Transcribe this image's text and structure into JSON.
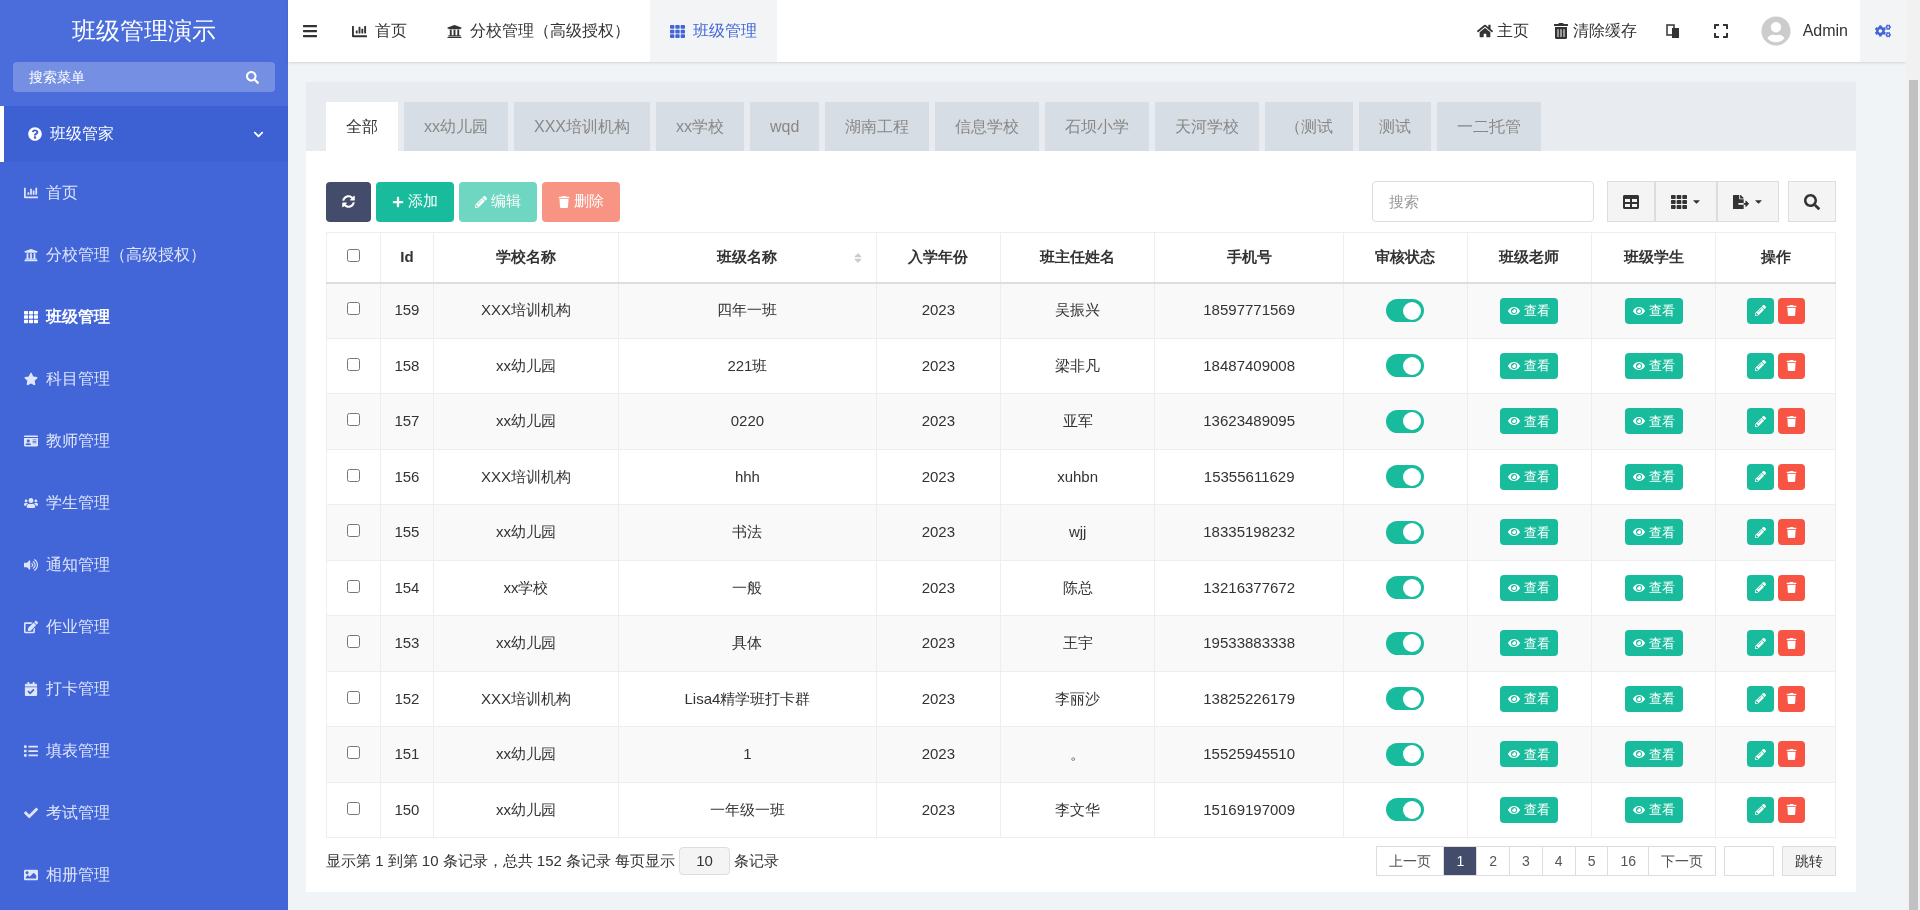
{
  "sidebar": {
    "title": "班级管理演示",
    "search": {
      "placeholder": "搜索菜单"
    },
    "group": {
      "label": "班级管家",
      "expanded": true
    },
    "items": [
      {
        "label": "首页",
        "selected": false
      },
      {
        "label": "分校管理（高级授权）",
        "selected": false
      },
      {
        "label": "班级管理",
        "selected": true
      },
      {
        "label": "科目管理",
        "selected": false
      },
      {
        "label": "教师管理",
        "selected": false
      },
      {
        "label": "学生管理",
        "selected": false
      },
      {
        "label": "通知管理",
        "selected": false
      },
      {
        "label": "作业管理",
        "selected": false
      },
      {
        "label": "打卡管理",
        "selected": false
      },
      {
        "label": "填表管理",
        "selected": false
      },
      {
        "label": "考试管理",
        "selected": false
      },
      {
        "label": "相册管理",
        "selected": false
      }
    ]
  },
  "topbar": {
    "tabs": [
      {
        "label": "首页",
        "selected": false
      },
      {
        "label": "分校管理（高级授权）",
        "selected": false
      },
      {
        "label": "班级管理",
        "selected": true
      }
    ],
    "home": "主页",
    "clear_cache": "清除缓存",
    "user": "Admin"
  },
  "filter_tabs": [
    {
      "label": "全部",
      "selected": true
    },
    {
      "label": "xx幼儿园",
      "selected": false
    },
    {
      "label": "XXX培训机构",
      "selected": false
    },
    {
      "label": "xx学校",
      "selected": false
    },
    {
      "label": "wqd",
      "selected": false
    },
    {
      "label": "湖南工程",
      "selected": false
    },
    {
      "label": "信息学校",
      "selected": false
    },
    {
      "label": "石坝小学",
      "selected": false
    },
    {
      "label": "天河学校",
      "selected": false
    },
    {
      "label": "（测试",
      "selected": false
    },
    {
      "label": "测试",
      "selected": false
    },
    {
      "label": "一二托管",
      "selected": false
    }
  ],
  "toolbar": {
    "add": "添加",
    "edit": "编辑",
    "delete": "删除",
    "search": {
      "placeholder": "搜索"
    }
  },
  "table": {
    "columns": [
      "Id",
      "学校名称",
      "班级名称",
      "入学年份",
      "班主任姓名",
      "手机号",
      "审核状态",
      "班级老师",
      "班级学生",
      "操作"
    ],
    "select_all": {
      "checked": false
    },
    "rows": [
      {
        "id": "159",
        "school": "XXX培训机构",
        "class": "四年一班",
        "year": "2023",
        "teacher": "吴振兴",
        "phone": "18597771569",
        "checked": false,
        "approved": true,
        "teacher_view": "查看",
        "student_view": "查看"
      },
      {
        "id": "158",
        "school": "xx幼儿园",
        "class": "221班",
        "year": "2023",
        "teacher": "梁非凡",
        "phone": "18487409008",
        "checked": false,
        "approved": true,
        "teacher_view": "查看",
        "student_view": "查看"
      },
      {
        "id": "157",
        "school": "xx幼儿园",
        "class": "0220",
        "year": "2023",
        "teacher": "亚军",
        "phone": "13623489095",
        "checked": false,
        "approved": true,
        "teacher_view": "查看",
        "student_view": "查看"
      },
      {
        "id": "156",
        "school": "XXX培训机构",
        "class": "hhh",
        "year": "2023",
        "teacher": "xuhbn",
        "phone": "15355611629",
        "checked": false,
        "approved": true,
        "teacher_view": "查看",
        "student_view": "查看"
      },
      {
        "id": "155",
        "school": "xx幼儿园",
        "class": "书法",
        "year": "2023",
        "teacher": "wjj",
        "phone": "18335198232",
        "checked": false,
        "approved": true,
        "teacher_view": "查看",
        "student_view": "查看"
      },
      {
        "id": "154",
        "school": "xx学校",
        "class": "一般",
        "year": "2023",
        "teacher": "陈总",
        "phone": "13216377672",
        "checked": false,
        "approved": true,
        "teacher_view": "查看",
        "student_view": "查看"
      },
      {
        "id": "153",
        "school": "xx幼儿园",
        "class": "具体",
        "year": "2023",
        "teacher": "王宇",
        "phone": "19533883338",
        "checked": false,
        "approved": true,
        "teacher_view": "查看",
        "student_view": "查看"
      },
      {
        "id": "152",
        "school": "XXX培训机构",
        "class": "Lisa4精学班打卡群",
        "year": "2023",
        "teacher": "李丽沙",
        "phone": "13825226179",
        "checked": false,
        "approved": true,
        "teacher_view": "查看",
        "student_view": "查看"
      },
      {
        "id": "151",
        "school": "xx幼儿园",
        "class": "1",
        "year": "2023",
        "teacher": "。",
        "phone": "15525945510",
        "checked": false,
        "approved": true,
        "teacher_view": "查看",
        "student_view": "查看"
      },
      {
        "id": "150",
        "school": "xx幼儿园",
        "class": "一年级一班",
        "year": "2023",
        "teacher": "李文华",
        "phone": "15169197009",
        "checked": false,
        "approved": true,
        "teacher_view": "查看",
        "student_view": "查看"
      }
    ]
  },
  "footer": {
    "summary": "显示第 1 到第 10 条记录，总共 152 条记录 每页显示",
    "page_size": "10",
    "records_suffix": "条记录",
    "pages": [
      {
        "label": "上一页",
        "selected": false
      },
      {
        "label": "1",
        "selected": true
      },
      {
        "label": "2",
        "selected": false
      },
      {
        "label": "3",
        "selected": false
      },
      {
        "label": "4",
        "selected": false
      },
      {
        "label": "5",
        "selected": false
      },
      {
        "label": "16",
        "selected": false
      },
      {
        "label": "下一页",
        "selected": false
      }
    ],
    "jump": "跳转"
  }
}
